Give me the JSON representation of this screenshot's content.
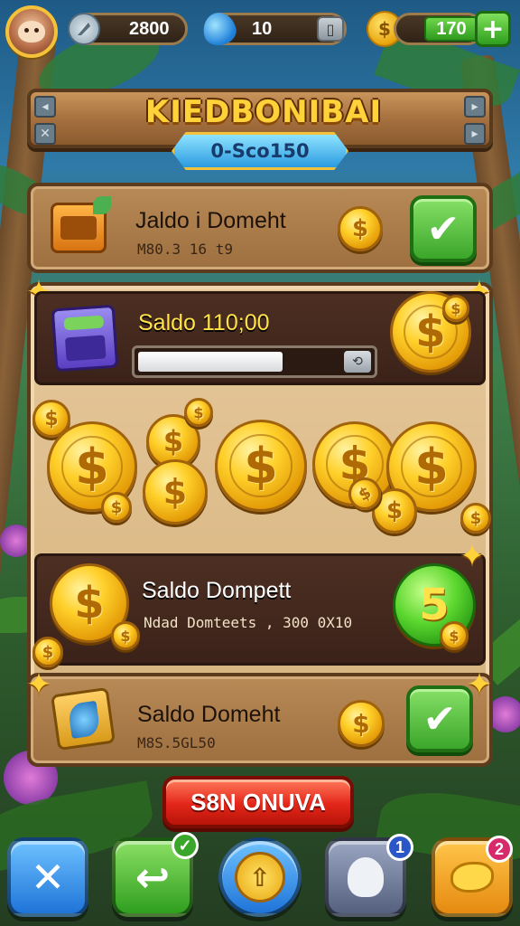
{
  "topbar": {
    "currency1_value": "2800",
    "currency2_value": "10",
    "currency3_value": "170",
    "add_label": "+"
  },
  "banner": {
    "title": "KIEDBONIBAI",
    "subtitle": "0-Sco150"
  },
  "row1": {
    "title": "Jaldo i Domeht",
    "subtitle": "M80.3 16 t9",
    "coin_symbol": "$",
    "check": "✔"
  },
  "balance": {
    "title": "Saldo 110;00",
    "progress_fraction": 0.72,
    "knob": "⟲"
  },
  "row2": {
    "title": "Saldo Dompett",
    "subtitle": "Ndad Domteets , 300 0X10",
    "coin_symbol": "$",
    "green_coin_symbol": "5"
  },
  "row3": {
    "title": "Saldo Domeht",
    "subtitle": "M8S.5GL50",
    "coin_symbol": "$",
    "check": "✔"
  },
  "claim_button": {
    "label": "S8N ONUVA"
  },
  "bottom_nav": {
    "close": "✕",
    "back": "↩",
    "center": "⇧",
    "badge1": "1",
    "badge2": "2"
  },
  "colors": {
    "gold": "#ffd02a",
    "wood": "#a7713f",
    "green": "#3aa62a",
    "red": "#e3261a",
    "blue": "#1f74d8"
  }
}
